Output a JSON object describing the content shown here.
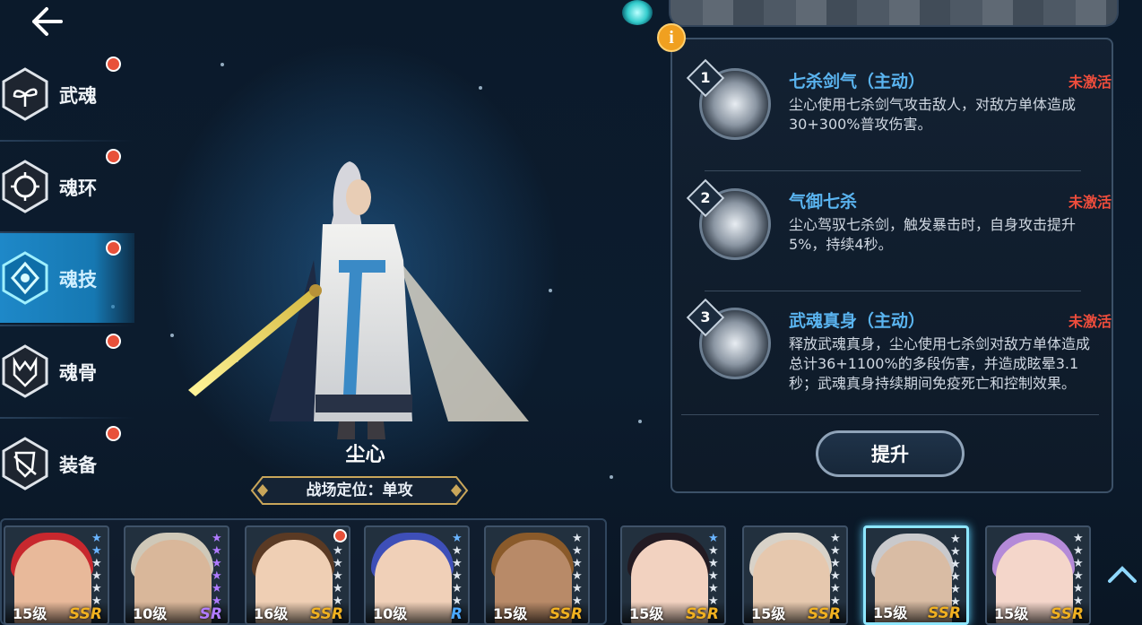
{
  "nav": {
    "items": [
      {
        "label": "武魂",
        "icon": "martial-soul-icon"
      },
      {
        "label": "魂环",
        "icon": "soul-ring-icon"
      },
      {
        "label": "魂技",
        "icon": "soul-skill-icon",
        "active": true
      },
      {
        "label": "魂骨",
        "icon": "soul-bone-icon"
      },
      {
        "label": "装备",
        "icon": "equipment-icon"
      }
    ]
  },
  "hero": {
    "name": "尘心",
    "role": "战场定位：单攻"
  },
  "skills": {
    "items": [
      {
        "num": "1",
        "title": "七杀剑气（主动）",
        "state": "未激活",
        "desc": "尘心使用七杀剑气攻击敌人，对敌方单体造成30+300%普攻伤害。"
      },
      {
        "num": "2",
        "title": "气御七杀",
        "state": "未激活",
        "desc": "尘心驾驭七杀剑，触发暴击时，自身攻击提升5%，持续4秒。"
      },
      {
        "num": "3",
        "title": "武魂真身（主动）",
        "state": "未激活",
        "desc": "释放武魂真身，尘心使用七杀剑对敌方单体造成总计36+1100%的多段伤害，并造成眩晕3.1秒；武魂真身持续期间免疫死亡和控制效果。"
      }
    ],
    "upgrade_label": "提升",
    "info_glyph": "i"
  },
  "roster": {
    "cards": [
      {
        "level": "15级",
        "rarity": "SSR",
        "stars": "blue",
        "red_dot": false,
        "selected": false
      },
      {
        "level": "10级",
        "rarity": "SR",
        "stars": "purple",
        "red_dot": false,
        "selected": false
      },
      {
        "level": "16级",
        "rarity": "SSR",
        "stars": "white",
        "red_dot": true,
        "selected": false
      },
      {
        "level": "10级",
        "rarity": "R",
        "stars": "blue",
        "red_dot": false,
        "selected": false
      },
      {
        "level": "15级",
        "rarity": "SSR",
        "stars": "white",
        "red_dot": false,
        "selected": false
      },
      {
        "level": "15级",
        "rarity": "SSR",
        "stars": "blue",
        "red_dot": false,
        "selected": false
      },
      {
        "level": "15级",
        "rarity": "SSR",
        "stars": "white",
        "red_dot": false,
        "selected": false
      },
      {
        "level": "15级",
        "rarity": "SSR",
        "stars": "white",
        "red_dot": false,
        "selected": true
      },
      {
        "level": "15级",
        "rarity": "SSR",
        "stars": "white",
        "red_dot": false,
        "selected": false
      }
    ]
  },
  "colors": {
    "accent": "#5ab4f0",
    "inactive_red": "#ef4d3c",
    "ssr_gold": "#f0b020",
    "sr_purple": "#b07bff",
    "r_blue": "#4aa8ff"
  }
}
